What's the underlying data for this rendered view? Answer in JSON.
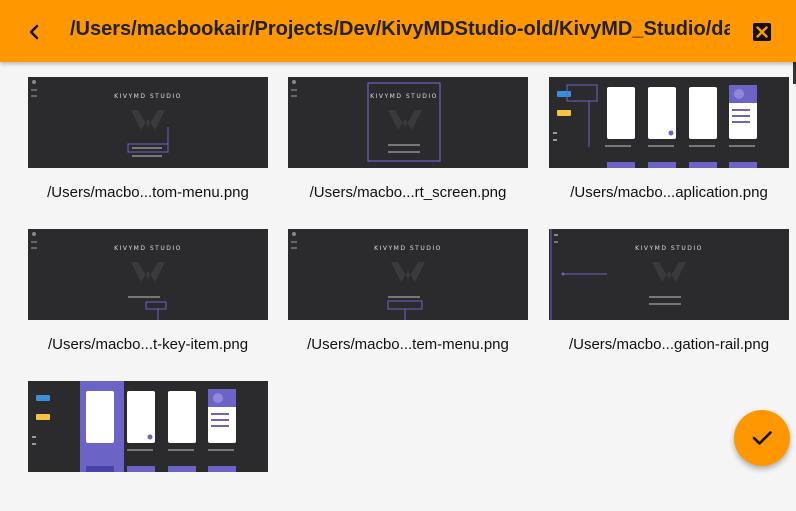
{
  "header": {
    "title": "/Users/macbookair/Projects/Dev/KivyMDStudio-old/KivyMD_Studio/da...",
    "back_icon": "chevron-left-icon",
    "close_icon": "close-box-icon"
  },
  "colors": {
    "accent": "#ff9800",
    "thumb_dark": "#2b2b2d",
    "thumb_light": "#ececf2",
    "violet": "#6c63c7"
  },
  "files": [
    {
      "caption": "/Users/macbo...tom-menu.png",
      "kind": "logo-menu"
    },
    {
      "caption": "/Users/macbo...rt_screen.png",
      "kind": "logo-box"
    },
    {
      "caption": "/Users/macbo...aplication.png",
      "kind": "app-screens"
    },
    {
      "caption": "/Users/macbo...t-key-item.png",
      "kind": "logo-menu"
    },
    {
      "caption": "/Users/macbo...tem-menu.png",
      "kind": "logo-menu"
    },
    {
      "caption": "/Users/macbo...gation-rail.png",
      "kind": "logo-rail"
    },
    {
      "caption": "",
      "kind": "app-screens-selected"
    }
  ],
  "fab": {
    "icon": "check-icon"
  }
}
